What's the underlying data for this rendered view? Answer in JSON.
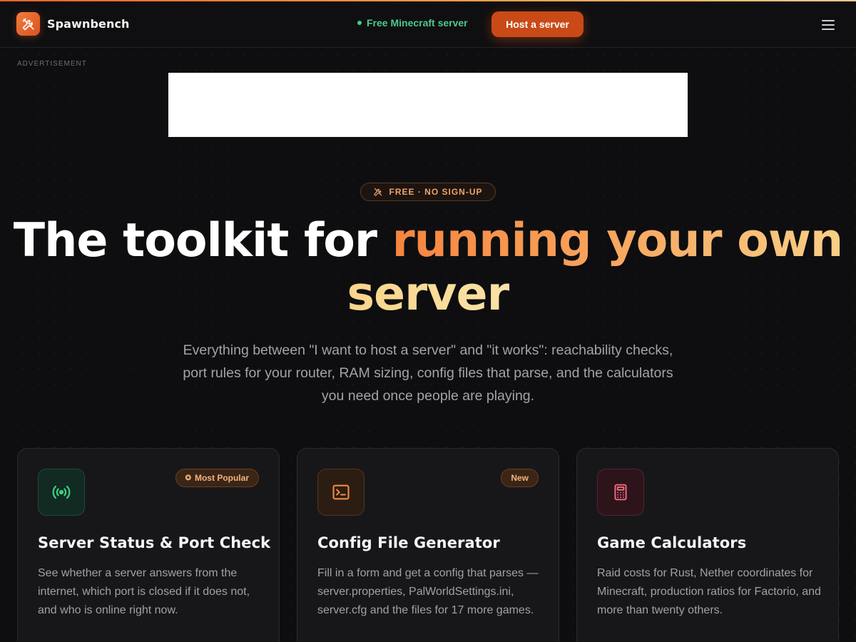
{
  "header": {
    "brand_name": "Spawnbench",
    "status_text": "Free Minecraft server",
    "host_button": "Host a server",
    "menu_icon": "hamburger-menu-icon"
  },
  "ad": {
    "label": "ADVERTISEMENT"
  },
  "hero": {
    "badge": "FREE · NO SIGN-UP",
    "title_plain": "The toolkit for ",
    "title_highlight": "running your own",
    "title_highlight_2": "server",
    "lede": "Everything between \"I want to host a server\" and \"it works\": reachability checks, port rules for your router, RAM sizing, config files that parse, and the calculators you need once people are playing."
  },
  "cards": [
    {
      "icon": "signal-broadcast-icon",
      "tag": "Most Popular",
      "title": "Server Status & Port Check",
      "description": "See whether a server answers from the internet, which port is closed if it does not, and who is online right now."
    },
    {
      "icon": "terminal-icon",
      "tag": "New",
      "title": "Config File Generator",
      "description": "Fill in a form and get a config that parses — server.properties, PalWorldSettings.ini, server.cfg and the files for 17 more games."
    },
    {
      "icon": "calculator-icon",
      "tag": "",
      "title": "Game Calculators",
      "description": "Raid costs for Rust, Nether coordinates for Minecraft, production ratios for Factorio, and more than twenty others."
    }
  ],
  "colors": {
    "accent": "#c94a17",
    "status_green": "#4fc98a",
    "background": "#0e0e10"
  }
}
